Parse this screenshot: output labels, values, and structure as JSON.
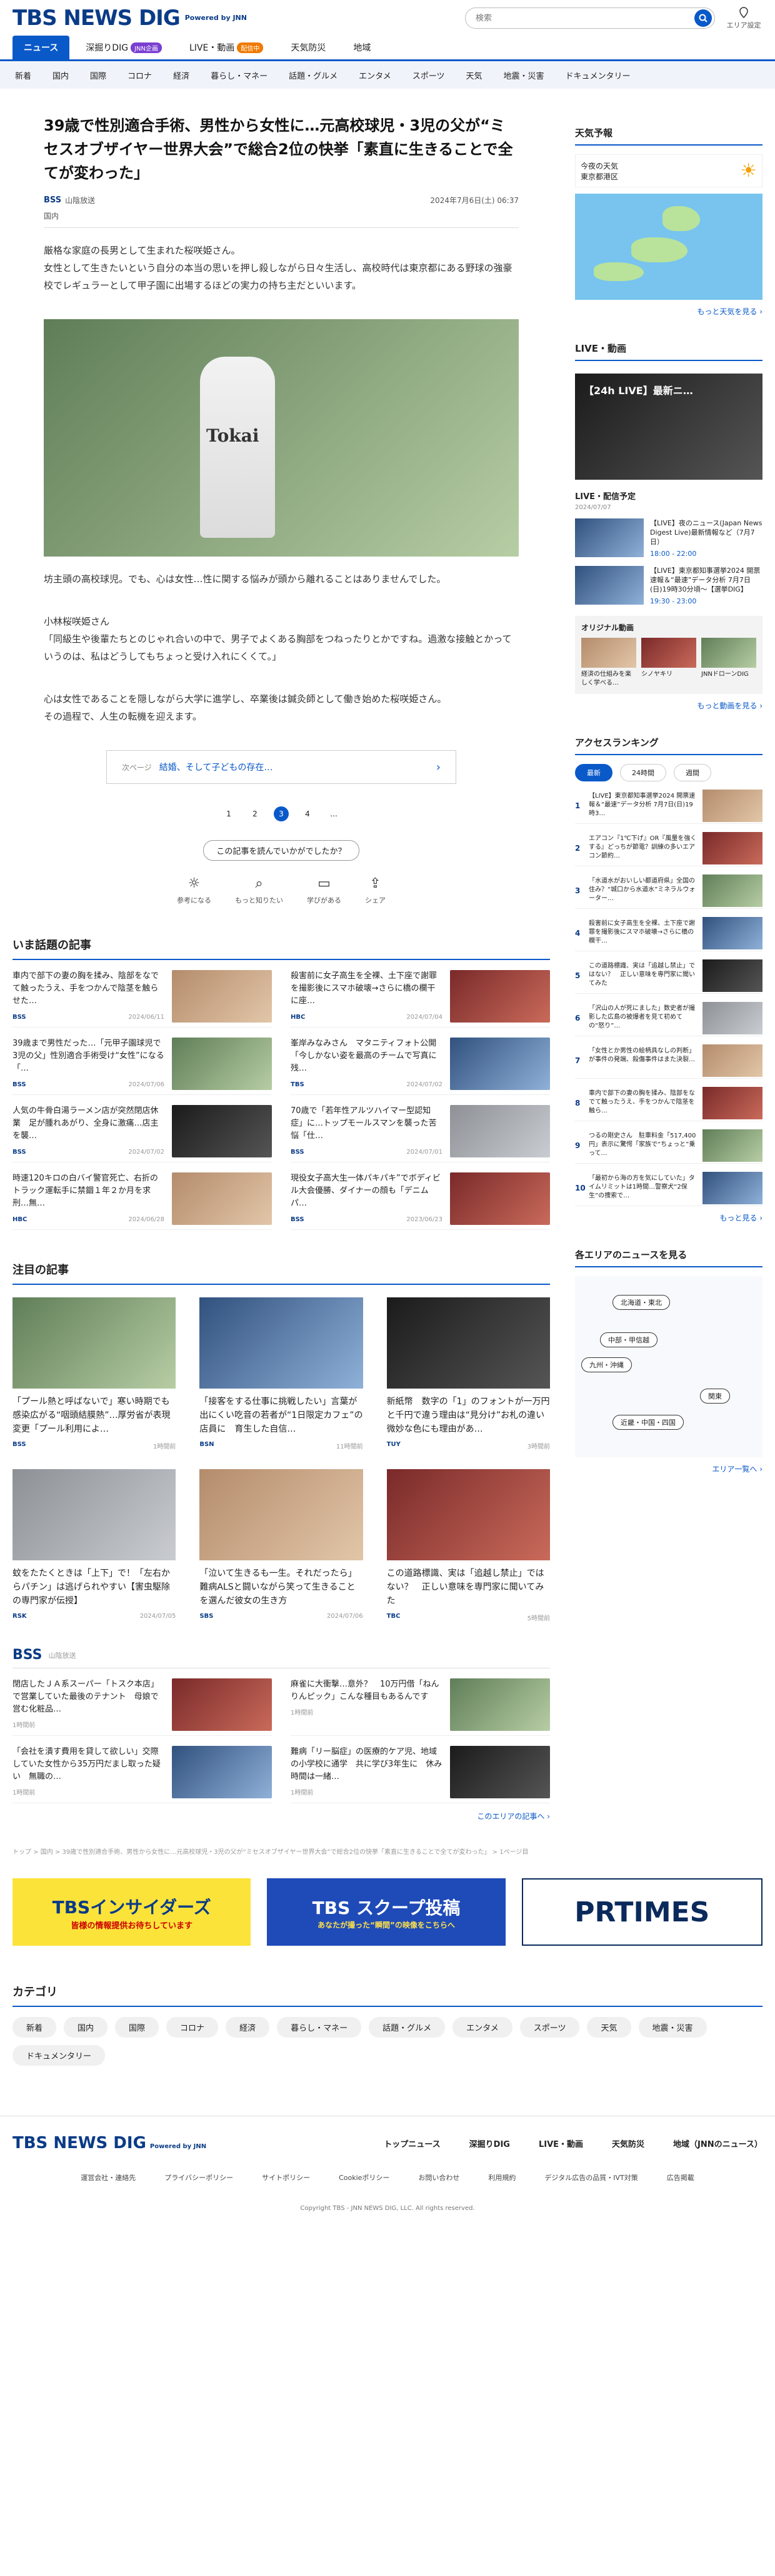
{
  "header": {
    "logo": "TBS NEWS DIG",
    "powered": "Powered by JNN",
    "search_placeholder": "検索",
    "area_label": "エリア設定"
  },
  "nav1": [
    {
      "label": "ニュース",
      "active": true
    },
    {
      "label": "深掘りDIG",
      "badge": "JNN企画"
    },
    {
      "label": "LIVE・動画",
      "badge": "配信中"
    },
    {
      "label": "天気防災"
    },
    {
      "label": "地域"
    }
  ],
  "nav2": [
    "新着",
    "国内",
    "国際",
    "コロナ",
    "経済",
    "暮らし・マネー",
    "話題・グルメ",
    "エンタメ",
    "スポーツ",
    "天気",
    "地震・災害",
    "ドキュメンタリー"
  ],
  "article": {
    "title": "39歳で性別適合手術、男性から女性に…元高校球児・3児の父が“ミセスオブザイヤー世界大会”で総合2位の快挙「素直に生きることで全てが変わった」",
    "source_logo": "BSS",
    "source": "山陰放送",
    "date": "2024年7月6日(土) 06:37",
    "category": "国内",
    "paragraphs": [
      "厳格な家庭の長男として生まれた桜咲姫さん。",
      "女性として生きたいという自分の本当の思いを押し殺しながら日々生活し、高校時代は東京都にある野球の強豪校でレギュラーとして甲子園に出場するほどの実力の持ち主だといいます。"
    ],
    "photo_text": "Tokai",
    "paragraphs2": [
      "坊主頭の高校球児。でも、心は女性…性に関する悩みが頭から離れることはありませんでした。",
      "小林桜咲姫さん",
      "「同級生や後輩たちとのじゃれ合いの中で、男子でよくある胸部をつねったりとかですね。過激な接触とかっていうのは、私はどうしてもちょっと受け入れにくくて。」",
      "心は女性であることを隠しながら大学に進学し、卒業後は鍼灸師として働き始めた桜咲姫さん。",
      "その過程で、人生の転機を迎えます。"
    ],
    "next_label": "次ページ",
    "next_title": "結婚、そして子どもの存在…",
    "pages": [
      "1",
      "2",
      "3",
      "4",
      "…"
    ],
    "feedback": "この記事を読んでいかがでしたか？",
    "reactions": [
      {
        "icon": "lightbulb-icon",
        "glyph": "☼",
        "label": "参考になる"
      },
      {
        "icon": "search-icon",
        "glyph": "⌕",
        "label": "もっと知りたい"
      },
      {
        "icon": "book-icon",
        "glyph": "▭",
        "label": "学びがある"
      },
      {
        "icon": "share-icon",
        "glyph": "⇪",
        "label": "シェア"
      }
    ]
  },
  "hot": {
    "title": "いま話題の記事",
    "items": [
      {
        "text": "車内で部下の妻の胸を揉み、陰部をなでて触ったうえ、手をつかんで陰茎を触らせた…",
        "src": "BSS",
        "date": "2024/06/11"
      },
      {
        "text": "殺害前に女子高生を全裸、土下座で謝罪を撮影後にスマホ破壊→さらに橋の欄干に座…",
        "src": "HBC",
        "date": "2024/07/04"
      },
      {
        "text": "39歳まで男性だった…「元甲子園球児で3児の父」性別適合手術受け“女性”になる「…",
        "src": "BSS",
        "date": "2024/07/06"
      },
      {
        "text": "峯岸みなみさん　マタニティフォト公開　「今しかない姿を最高のチームで写真に残…",
        "src": "TBS",
        "date": "2024/07/02"
      },
      {
        "text": "人気の牛骨白湯ラーメン店が突然閉店休業　足が腫れあがり、全身に激痛…店主を襲…",
        "src": "BSS",
        "date": "2024/07/02"
      },
      {
        "text": "70歳で「若年性アルツハイマー型認知症」に…トップモールスマンを襲った苦悩「仕…",
        "src": "BSS",
        "date": "2024/07/01"
      },
      {
        "text": "時速120キロの白バイ警官死亡、右折のトラック運転手に禁錮１年２か月を求刑…無…",
        "src": "HBC",
        "date": "2024/06/28"
      },
      {
        "text": "現役女子高大生一体パキパキ”でボディビル大会優勝、ダイナーの顔も「デニムパ…",
        "src": "BSS",
        "date": "2023/06/23"
      }
    ]
  },
  "featured": {
    "title": "注目の記事",
    "items": [
      {
        "text": "「プール熱と呼ばないで」寒い時期でも感染広がる“咽頭結膜熱”…厚労省が表現変更「プール利用によ…",
        "src": "BSS",
        "date": "1時間前"
      },
      {
        "text": "「接客をする仕事に挑戦したい」言葉が出にくい吃音の若者が“1日限定カフェ”の店員に　育生した自信…",
        "src": "BSN",
        "date": "11時間前"
      },
      {
        "text": "新紙幣　数字の「1」のフォントが一万円と千円で違う理由は“見分け”お札の違い微妙な色にも理由があ…",
        "src": "TUY",
        "date": "3時間前"
      },
      {
        "text": "蚊をたたくときは「上下」で！「左右からパチン」は逃げられやすい【害虫駆除の専門家が伝授】",
        "src": "RSK",
        "date": "2024/07/05"
      },
      {
        "text": "「泣いて生きるも一生。それだったら」難病ALSと闘いながら笑って生きることを選んだ彼女の生き方",
        "src": "SBS",
        "date": "2024/07/06"
      },
      {
        "text": "この道路標識、実は「追越し禁止」ではない？　正しい意味を専門家に聞いてみた",
        "src": "TBC",
        "date": "5時間前"
      }
    ]
  },
  "bss": {
    "logo": "BSS",
    "name": "山陰放送",
    "items": [
      {
        "text": "閉店したＪＡ系スーパー「トスク本店」で営業していた最後のテナント　母娘で営む化粧品…",
        "date": "1時間前"
      },
      {
        "text": "麻雀に大衝撃…意外？　10万円借「ねんりんピック」こんな種目もあるんです",
        "date": "1時間前"
      },
      {
        "text": "「会社を潰す費用を貸して欲しい」交際していた女性から35万円だまし取った疑い　無職の…",
        "date": "1時間前"
      },
      {
        "text": "難病「リー脳症」の医療的ケア児、地域の小学校に通学　共に学び3年生に　休み時間は一緒…",
        "date": "1時間前"
      }
    ],
    "more": "このエリアの記事へ ›"
  },
  "breadcrumb": "トップ > 国内 > 39歳で性別適合手術、男性から女性に…元高校球児・3児の父が“ミセスオブザイヤー世界大会”で総合2位の快挙「素直に生きることで全てが変わった」 > 1ページ目",
  "banners": [
    {
      "text": "TBSインサイダーズ",
      "sub": "皆様の情報提供お待ちしています"
    },
    {
      "text": "TBS スクープ投稿",
      "sub": "あなたが撮った“瞬間”の映像をこちらへ"
    },
    {
      "text": "PRTIMES"
    }
  ],
  "categories": {
    "title": "カテゴリ",
    "items": [
      "新着",
      "国内",
      "国際",
      "コロナ",
      "経済",
      "暮らし・マネー",
      "話題・グルメ",
      "エンタメ",
      "スポーツ",
      "天気",
      "地震・災害",
      "ドキュメンタリー"
    ]
  },
  "side": {
    "weather": {
      "title": "天気予報",
      "label1": "今夜の天気",
      "label2": "東京都港区",
      "more": "もっと天気を見る ›"
    },
    "live": {
      "title": "LIVE・動画",
      "video_title": "【24h LIVE】最新ニ…",
      "sched_title": "LIVE・配信予定",
      "sched_date": "2024/07/07",
      "sched": [
        {
          "text": "【LIVE】夜のニュース(Japan News Digest Live)最新情報など（7月7日）",
          "time": "18:00 - 22:00"
        },
        {
          "text": "【LIVE】東京都知事選挙2024 開票速報＆“最速”データ分析 7月7日(日)19時30分頃〜【選挙DIG】",
          "time": "19:30 - 23:00"
        }
      ],
      "orig_title": "オリジナル動画",
      "orig": [
        "経済の仕組みを楽しく学べる…",
        "シノヤキリ",
        "JNNドローンDIG"
      ],
      "more": "もっと動画を見る ›"
    },
    "ranking": {
      "title": "アクセスランキング",
      "tabs": [
        "最新",
        "24時間",
        "週間"
      ],
      "items": [
        "【LIVE】東京都知事選挙2024 開票速報＆“最速”データ分析 7月7日(日)19時3…",
        "エアコン『1℃下げ』OR『風量を強くする』どっちが節電？訓練の多いエアコン節約…",
        "「水道水がおいしい都道府県」全国の住み？“城口から水道水”ミネラルウォーター…",
        "殺害前に女子高生を全裸、土下座で謝罪を撮影後にスマホ破壊→さらに橋の欄干…",
        "この道路標識、実は「追越し禁止」ではない？　正しい意味を専門家に聞いてみた",
        "「沢山の人が死にました」数史者が撮影した広島の被爆者を見て初めての“怒り”…",
        "「女性とか男性の絵柄具なしの判断」が事件の発端、殺傷事件はまた決裂…",
        "車内で部下の妻の胸を揉み、陰部をなでて触ったうえ、手をつかんで陰茎を触ら…",
        "つるの剛史さん　駐車料金「517,400円」表示に驚愕「家族で“ちょっと”乗って…",
        "「最初から海の方を気にしていた」タイムリミットは1時間…警察犬“2保生”の捜索で…"
      ],
      "more": "もっと見る ›"
    },
    "areas": {
      "title": "各エリアのニュースを見る",
      "pills": [
        "北海道・東北",
        "中部・甲信越",
        "九州・沖縄",
        "関東",
        "近畿・中国・四国"
      ],
      "more": "エリア一覧へ ›"
    }
  },
  "footer": {
    "logo": "TBS NEWS DIG",
    "powered": "Powered by JNN",
    "links": [
      "トップニュース",
      "深掘りDIG",
      "LIVE・動画",
      "天気防災",
      "地域（JNNのニュース）"
    ],
    "sub": [
      "運営会社・連絡先",
      "プライバシーポリシー",
      "サイトポリシー",
      "Cookieポリシー",
      "お問い合わせ",
      "利用規約",
      "デジタル広告の品質・IVT対策",
      "広告掲載"
    ],
    "copy": "Copyright TBS - JNN NEWS DIG, LLC. All rights reserved."
  }
}
